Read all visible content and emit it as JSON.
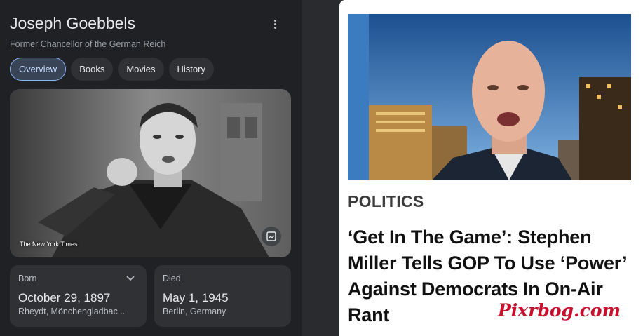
{
  "knowledge_panel": {
    "title": "Joseph Goebbels",
    "subtitle": "Former Chancellor of the German Reich",
    "tabs": [
      {
        "label": "Overview",
        "active": true
      },
      {
        "label": "Books",
        "active": false
      },
      {
        "label": "Movies",
        "active": false
      },
      {
        "label": "History",
        "active": false
      }
    ],
    "image_credit": "The New York Times",
    "born": {
      "label": "Born",
      "date": "October 29, 1897",
      "place": "Rheydt, Mönchengladbac..."
    },
    "died": {
      "label": "Died",
      "date": "May 1, 1945",
      "place": "Berlin, Germany"
    }
  },
  "article": {
    "section": "POLITICS",
    "headline": "‘Get In The Game’: Stephen Miller Tells GOP To Use ‘Power’ Against Democrats In On-Air Rant",
    "watermark": "Pixrbog.com"
  },
  "colors": {
    "panel_bg": "#202124",
    "chip_bg": "#303134",
    "active_chip_border": "#8ab4f8",
    "watermark_red": "#c8102e"
  }
}
